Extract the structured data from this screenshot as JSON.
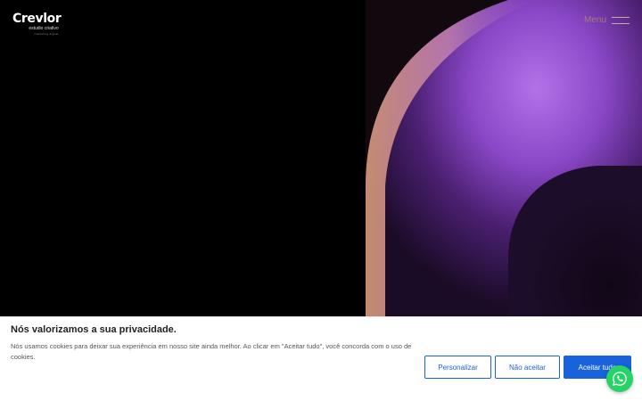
{
  "brand": {
    "name": "Crevlor",
    "subtitle": "estudio criativo",
    "tagline": "marketing digital"
  },
  "nav": {
    "menu_label": "Menu"
  },
  "cookie_banner": {
    "title": "Nós valorizamos a sua privacidade.",
    "text": "Nós usamos cookies para deixar sua experiência em nosso site ainda melhor. Ao clicar em \"Aceitar tudo\", você concorda com o uso de cookies.",
    "customize_label": "Personalizar",
    "reject_label": "Não aceitar",
    "accept_label": "Aceitar tudo"
  },
  "colors": {
    "accent": "#1863dc",
    "whatsapp": "#25d366",
    "background": "#000000"
  },
  "icons": {
    "menu": "hamburger-icon",
    "whatsapp": "whatsapp-icon"
  }
}
